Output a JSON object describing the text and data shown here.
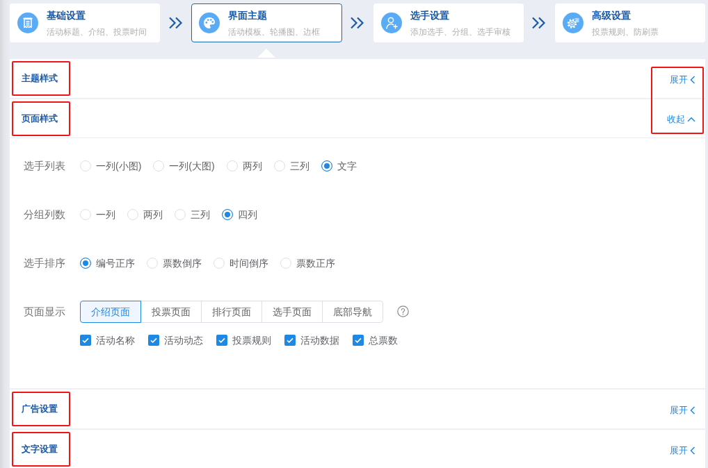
{
  "steps": [
    {
      "title": "基础设置",
      "subtitle": "活动标题、介绍、投票时间",
      "selected": false
    },
    {
      "title": "界面主题",
      "subtitle": "活动模板、轮播图、边框",
      "selected": true
    },
    {
      "title": "选手设置",
      "subtitle": "添加选手、分组、选手审核",
      "selected": false
    },
    {
      "title": "高级设置",
      "subtitle": "投票规则、防刷票",
      "selected": false
    }
  ],
  "sections": [
    {
      "title": "主题样式",
      "toggle": "展开",
      "expanded": false,
      "title_boxed": true,
      "toggle_boxed": true
    },
    {
      "title": "页面样式",
      "toggle": "收起",
      "expanded": true,
      "title_boxed": true,
      "toggle_boxed": true,
      "rows": [
        {
          "kind": "radio",
          "label": "选手列表",
          "options": [
            {
              "label": "一列(小图)",
              "selected": false
            },
            {
              "label": "一列(大图)",
              "selected": false
            },
            {
              "label": "两列",
              "selected": false
            },
            {
              "label": "三列",
              "selected": false
            },
            {
              "label": "文字",
              "selected": true
            }
          ]
        },
        {
          "kind": "radio",
          "label": "分组列数",
          "options": [
            {
              "label": "一列",
              "selected": false
            },
            {
              "label": "两列",
              "selected": false
            },
            {
              "label": "三列",
              "selected": false
            },
            {
              "label": "四列",
              "selected": true
            }
          ]
        },
        {
          "kind": "radio",
          "label": "选手排序",
          "options": [
            {
              "label": "编号正序",
              "selected": true
            },
            {
              "label": "票数倒序",
              "selected": false
            },
            {
              "label": "时间倒序",
              "selected": false
            },
            {
              "label": "票数正序",
              "selected": false
            }
          ]
        },
        {
          "kind": "tabs",
          "label": "页面显示",
          "options": [
            {
              "label": "介绍页面",
              "selected": true
            },
            {
              "label": "投票页面",
              "selected": false
            },
            {
              "label": "排行页面",
              "selected": false
            },
            {
              "label": "选手页面",
              "selected": false
            },
            {
              "label": "底部导航",
              "selected": false
            }
          ],
          "checkboxes": [
            {
              "label": "活动名称",
              "checked": true
            },
            {
              "label": "活动动态",
              "checked": true
            },
            {
              "label": "投票规则",
              "checked": true
            },
            {
              "label": "活动数据",
              "checked": true
            },
            {
              "label": "总票数",
              "checked": true
            }
          ]
        }
      ]
    },
    {
      "title": "广告设置",
      "toggle": "展开",
      "expanded": false,
      "title_boxed": true
    },
    {
      "title": "文字设置",
      "toggle": "展开",
      "expanded": false,
      "title_boxed": true
    }
  ]
}
